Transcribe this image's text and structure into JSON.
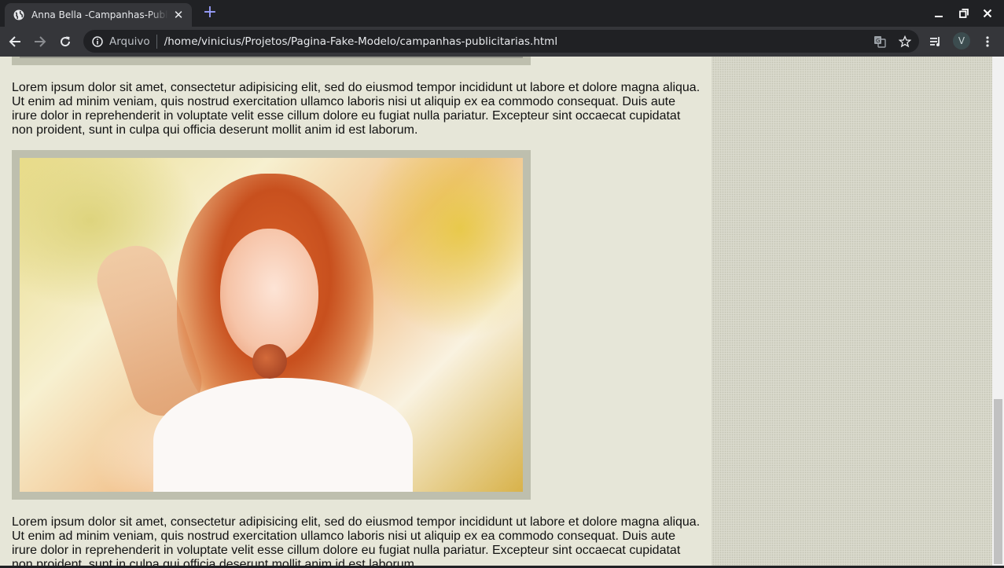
{
  "browser": {
    "tab_title": "Anna Bella -Campanhas-Publicitarias",
    "new_tab_label": "+",
    "omnibox": {
      "scheme_label": "Arquivo",
      "url": "/home/vinicius/Projetos/Pagina-Fake-Modelo/campanhas-publicitarias.html"
    },
    "profile_initial": "V",
    "colors": {
      "frame": "#202124",
      "toolbar": "#35363a",
      "page_bg": "#e6e6d8",
      "image_border": "#bebfae"
    }
  },
  "page": {
    "paragraphs": [
      "Lorem ipsum dolor sit amet, consectetur adipisicing elit, sed do eiusmod tempor incididunt ut labore et dolore magna aliqua. Ut enim ad minim veniam, quis nostrud exercitation ullamco laboris nisi ut aliquip ex ea commodo consequat. Duis aute irure dolor in reprehenderit in voluptate velit esse cillum dolore eu fugiat nulla pariatur. Excepteur sint occaecat cupidatat non proident, sunt in culpa qui officia deserunt mollit anim id est laborum.",
      "Lorem ipsum dolor sit amet, consectetur adipisicing elit, sed do eiusmod tempor incididunt ut labore et dolore magna aliqua. Ut enim ad minim veniam, quis nostrud exercitation ullamco laboris nisi ut aliquip ex ea commodo consequat. Duis aute irure dolor in reprehenderit in voluptate velit esse cillum dolore eu fugiat nulla pariatur. Excepteur sint occaecat cupidatat non proident, sunt in culpa qui officia deserunt mollit anim id est laborum."
    ]
  }
}
